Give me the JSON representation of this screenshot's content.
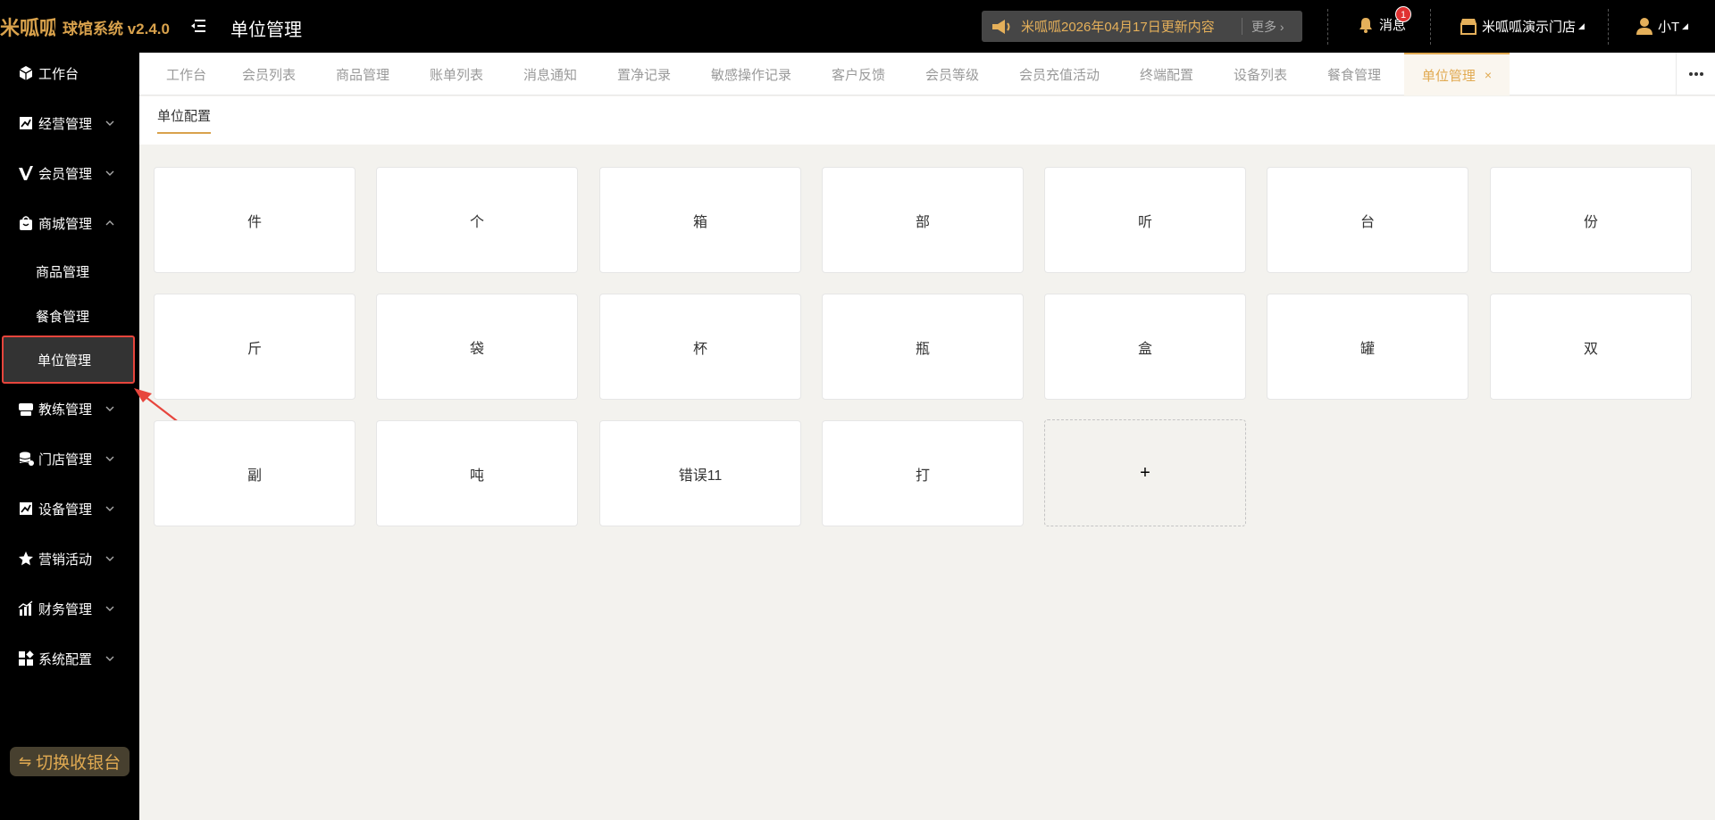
{
  "header": {
    "logo_text": "米呱呱",
    "brand": "球馆系统 v2.4.0",
    "page_title": "单位管理",
    "notice": {
      "text": "米呱呱2026年04月17日更新内容",
      "more": "更多"
    },
    "messages": {
      "label": "消息",
      "badge": "1"
    },
    "store": "米呱呱演示门店",
    "user": "小T"
  },
  "sidebar": {
    "items": [
      {
        "label": "工作台",
        "icon": "cube-icon"
      },
      {
        "label": "经营管理",
        "icon": "chart-box-icon"
      },
      {
        "label": "会员管理",
        "icon": "v-badge-icon"
      },
      {
        "label": "商城管理",
        "icon": "shopping-bag-icon"
      },
      {
        "label": "教练管理",
        "icon": "coach-icon"
      },
      {
        "label": "门店管理",
        "icon": "store-stack-icon"
      },
      {
        "label": "设备管理",
        "icon": "device-icon"
      },
      {
        "label": "营销活动",
        "icon": "star-icon"
      },
      {
        "label": "财务管理",
        "icon": "finance-chart-icon"
      },
      {
        "label": "系统配置",
        "icon": "grid-icon"
      }
    ],
    "sub_items": [
      "商品管理",
      "餐食管理",
      "单位管理"
    ],
    "switch_button": "切换收银台"
  },
  "tabs": [
    "工作台",
    "会员列表",
    "商品管理",
    "账单列表",
    "消息通知",
    "置净记录",
    "敏感操作记录",
    "客户反馈",
    "会员等级",
    "会员充值活动",
    "终端配置",
    "设备列表",
    "餐食管理"
  ],
  "active_tab": "单位管理",
  "subheader": {
    "tab": "单位配置"
  },
  "units": [
    "件",
    "个",
    "箱",
    "部",
    "听",
    "台",
    "份",
    "斤",
    "袋",
    "杯",
    "瓶",
    "盒",
    "罐",
    "双",
    "副",
    "吨",
    "错误11",
    "打"
  ],
  "add_label": "+",
  "colors": {
    "accent": "#e1aa52",
    "sidebar_bg": "#000000",
    "highlight_border": "#e7453c"
  }
}
